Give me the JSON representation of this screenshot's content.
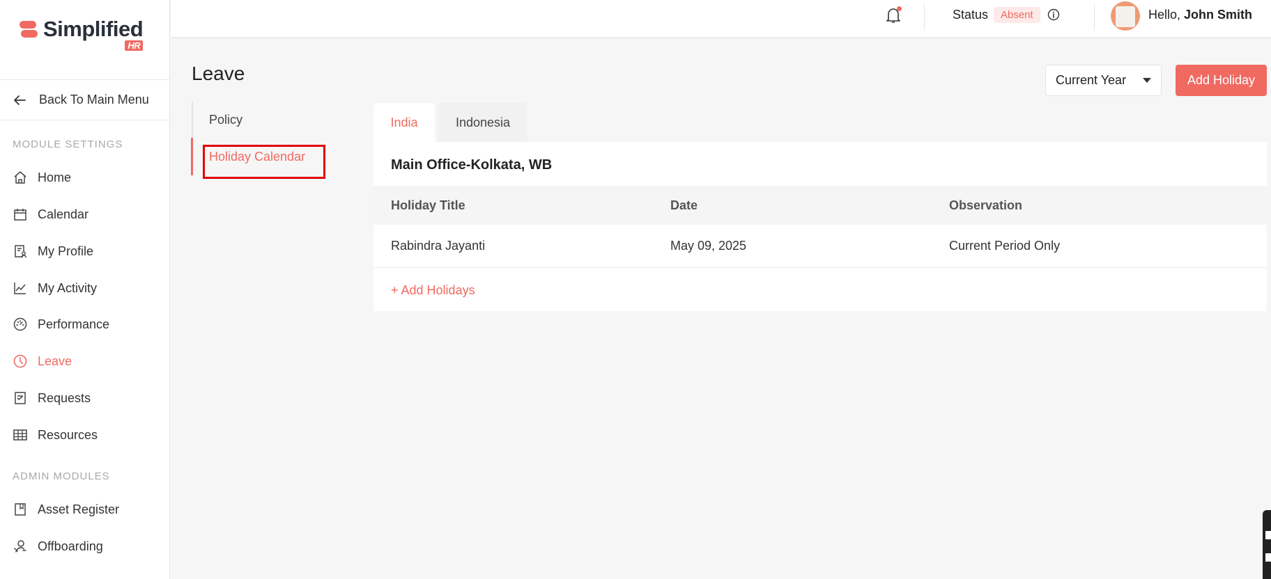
{
  "brand": {
    "name": "Simplified",
    "tag": "HR"
  },
  "sidebar": {
    "back_label": "Back To Main Menu",
    "module_settings_title": "MODULE SETTINGS",
    "items": [
      {
        "label": "Home",
        "icon": "home-icon"
      },
      {
        "label": "Calendar",
        "icon": "calendar-icon"
      },
      {
        "label": "My Profile",
        "icon": "profile-icon"
      },
      {
        "label": "My Activity",
        "icon": "activity-chart-icon"
      },
      {
        "label": "Performance",
        "icon": "gauge-icon"
      },
      {
        "label": "Leave",
        "icon": "clock-icon",
        "active": true
      },
      {
        "label": "Requests",
        "icon": "requests-icon"
      },
      {
        "label": "Resources",
        "icon": "table-grid-icon"
      }
    ],
    "admin_modules_title": "ADMIN MODULES",
    "admin_items": [
      {
        "label": "Asset Register",
        "icon": "bookmark-icon"
      },
      {
        "label": "Offboarding",
        "icon": "user-leave-icon"
      }
    ]
  },
  "header": {
    "status_label": "Status",
    "status_value": "Absent",
    "greeting": "Hello,",
    "user_name": "John Smith"
  },
  "page": {
    "title": "Leave",
    "subnav": [
      "Policy",
      "Holiday Calendar"
    ],
    "year_filter": "Current Year",
    "add_holiday_label": "Add Holiday",
    "tabs": [
      "India",
      "Indonesia"
    ],
    "office": "Main Office-Kolkata, WB",
    "columns": [
      "Holiday Title",
      "Date",
      "Observation"
    ],
    "rows": [
      {
        "title": "Rabindra Jayanti",
        "date": "May 09, 2025",
        "observation": "Current Period Only"
      }
    ],
    "add_holidays_label": "+ Add Holidays"
  },
  "colors": {
    "accent": "#f06a62",
    "highlight_box": "#e00000"
  }
}
